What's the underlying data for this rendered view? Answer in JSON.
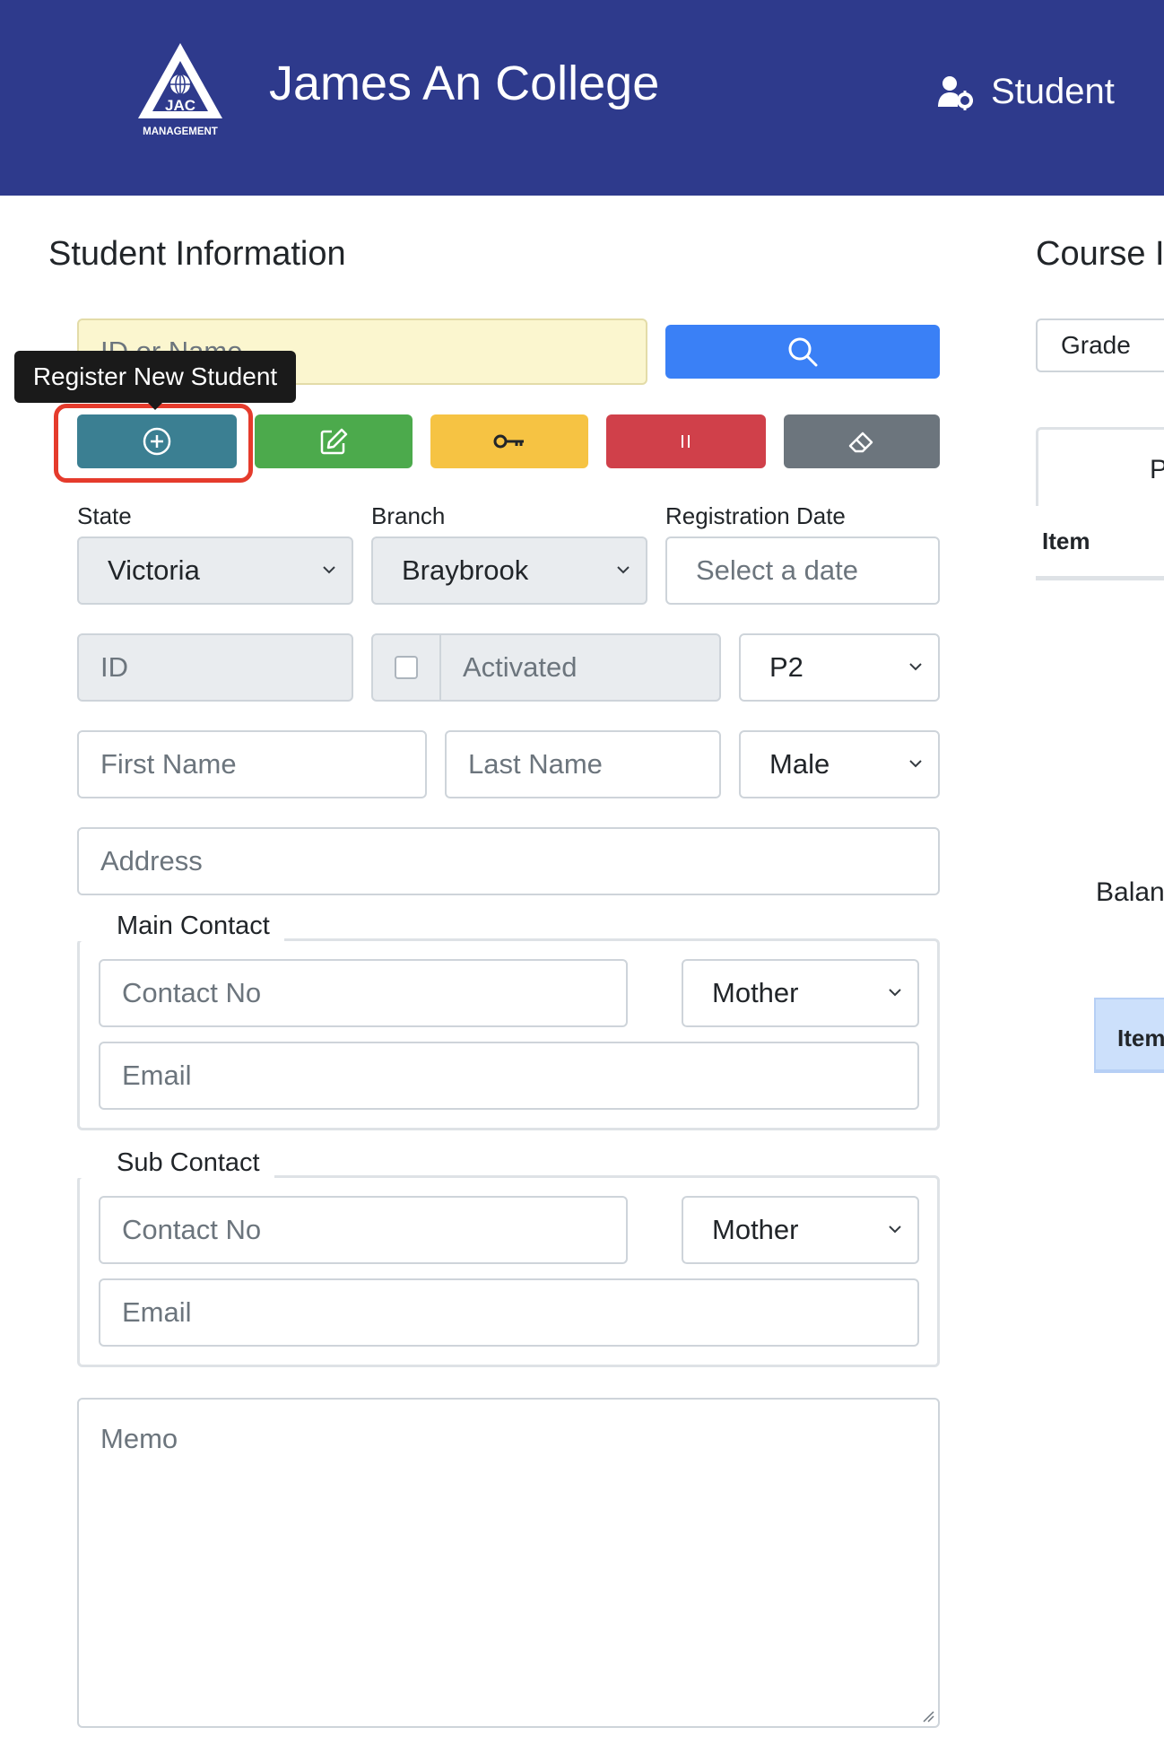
{
  "header": {
    "logo_text": "JAC",
    "logo_subtext": "MANAGEMENT",
    "college_name": "James An College",
    "user_label": "Student"
  },
  "student_info": {
    "title": "Student Information",
    "search": {
      "placeholder": "ID or Name"
    },
    "tooltip": "Register New Student",
    "labels": {
      "state": "State",
      "branch": "Branch",
      "registration_date": "Registration Date"
    },
    "state_value": "Victoria",
    "branch_value": "Braybrook",
    "registration_date_placeholder": "Select a date",
    "id_placeholder": "ID",
    "activated_label": "Activated",
    "level_value": "P2",
    "first_name_placeholder": "First Name",
    "last_name_placeholder": "Last Name",
    "gender_value": "Male",
    "address_placeholder": "Address",
    "main_contact": {
      "legend": "Main Contact",
      "contact_placeholder": "Contact No",
      "relation_value": "Mother",
      "email_placeholder": "Email"
    },
    "sub_contact": {
      "legend": "Sub Contact",
      "contact_placeholder": "Contact No",
      "relation_value": "Mother",
      "email_placeholder": "Email"
    },
    "memo_placeholder": "Memo"
  },
  "course": {
    "title": "Course I",
    "grade_label": "Grade",
    "tab_partial": "P",
    "item_header": "Item",
    "balance_partial": "Balan",
    "item_partial": "Item"
  },
  "colors": {
    "header_bg": "#2e3a8c",
    "register_btn": "#3b7f92",
    "edit_btn": "#4caa4c",
    "key_btn": "#f6c343",
    "pause_btn": "#d0404a",
    "clear_btn": "#6c757d",
    "search_btn": "#3a80f6",
    "search_input_bg": "#fbf6cf",
    "highlight": "#e53b2c"
  }
}
